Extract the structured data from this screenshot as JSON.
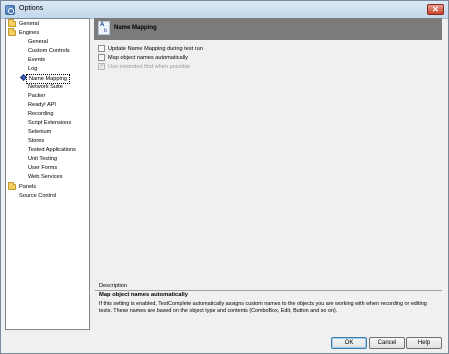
{
  "window": {
    "title": "Options",
    "close_label": "✕"
  },
  "tree": {
    "items": [
      {
        "label": "General",
        "level": 0,
        "icon": "folder-icon"
      },
      {
        "label": "Engines",
        "level": 0,
        "icon": "folder-icon"
      },
      {
        "label": "General",
        "level": 1
      },
      {
        "label": "Custom Controls",
        "level": 1
      },
      {
        "label": "Events",
        "level": 1
      },
      {
        "label": "Log",
        "level": 1
      },
      {
        "label": "Name Mapping",
        "level": 1,
        "selected": true,
        "icon": "name-mapping-diamond-icon"
      },
      {
        "label": "Network Suite",
        "level": 1
      },
      {
        "label": "Packer",
        "level": 1
      },
      {
        "label": "Ready! API",
        "level": 1
      },
      {
        "label": "Recording",
        "level": 1
      },
      {
        "label": "Script Extensions",
        "level": 1
      },
      {
        "label": "Selenium",
        "level": 1
      },
      {
        "label": "Stores",
        "level": 1
      },
      {
        "label": "Tested Applications",
        "level": 1
      },
      {
        "label": "Unit Testing",
        "level": 1
      },
      {
        "label": "User Forms",
        "level": 1
      },
      {
        "label": "Web Services",
        "level": 1
      },
      {
        "label": "Panels",
        "level": 0,
        "icon": "folder-icon"
      },
      {
        "label": "Source Control",
        "level": 0
      }
    ]
  },
  "header": {
    "title": "Name Mapping",
    "icon": "name-mapping-page-icon"
  },
  "options": [
    {
      "label": "Update Name Mapping during test run",
      "checked": false,
      "enabled": true
    },
    {
      "label": "Map object names automatically",
      "checked": false,
      "enabled": true
    },
    {
      "label": "Use extended find when possible",
      "checked": true,
      "enabled": false
    }
  ],
  "description": {
    "title": "Description",
    "heading": "Map object names automatically",
    "body": "If this setting is enabled, TestComplete automatically assigns custom names to the objects you are working with when recording or editing tests. These names are based on the object type and contents (ComboBox, Edit, Button and so on)."
  },
  "buttons": {
    "ok": "OK",
    "cancel": "Cancel",
    "help": "Help"
  }
}
